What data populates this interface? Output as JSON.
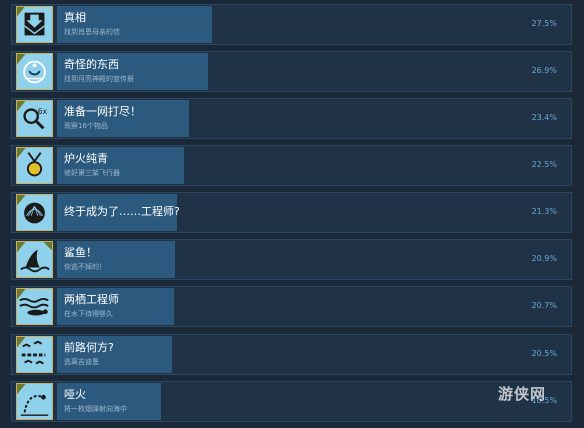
{
  "achievements": [
    {
      "title": "真相",
      "desc": "找到肖恩母亲的信",
      "percent": "27.5%",
      "icon": "envelope-down-icon",
      "fraction": 0.275
    },
    {
      "title": "奇怪的东西",
      "desc": "找到月亮神殿的宣传册",
      "percent": "26.9%",
      "icon": "moon-emblem-icon",
      "fraction": 0.269
    },
    {
      "title": "准备一网打尽！",
      "desc": "观察16个物品",
      "percent": "23.4%",
      "icon": "magnifier-6x-icon",
      "fraction": 0.234
    },
    {
      "title": "炉火纯青",
      "desc": "修好第三架飞行器",
      "percent": "22.5%",
      "icon": "medal-icon",
      "fraction": 0.225
    },
    {
      "title": "终于成为了……工程师?",
      "desc": "",
      "percent": "21.3%",
      "icon": "shell-emblem-icon",
      "fraction": 0.213
    },
    {
      "title": "鲨鱼！",
      "desc": "你逃不掉的！",
      "percent": "20.9%",
      "icon": "shark-fin-icon",
      "fraction": 0.209
    },
    {
      "title": "两栖工程师",
      "desc": "在水下待得够久",
      "percent": "20.7%",
      "icon": "swimmer-icon",
      "fraction": 0.207
    },
    {
      "title": "前路何方?",
      "desc": "逃离吉迪恩",
      "percent": "20.5%",
      "icon": "birds-icon",
      "fraction": 0.205
    },
    {
      "title": "哑火",
      "desc": "将一枚烟弹射向海中",
      "percent": "18.5%",
      "icon": "flare-arc-icon",
      "fraction": 0.185
    }
  ],
  "watermark": "游侠网"
}
